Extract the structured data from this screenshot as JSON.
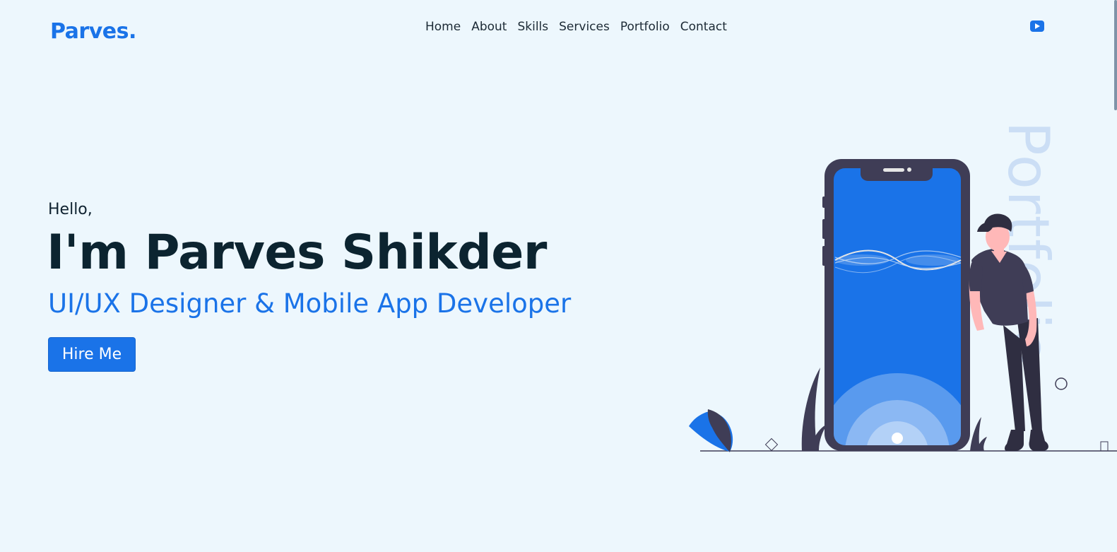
{
  "brand": {
    "logo": "Parves."
  },
  "nav": {
    "items": [
      {
        "label": "Home"
      },
      {
        "label": "About"
      },
      {
        "label": "Skills"
      },
      {
        "label": "Services"
      },
      {
        "label": "Portfolio"
      },
      {
        "label": "Contact"
      }
    ]
  },
  "social": {
    "icon": "youtube-icon"
  },
  "hero": {
    "greeting": "Hello,",
    "name": "I'm Parves Shikder",
    "role": "UI/UX Designer & Mobile App Developer",
    "cta_label": "Hire Me",
    "side_word": "Portfolio"
  },
  "colors": {
    "accent": "#1a73e8",
    "background": "#edf7fd",
    "heading": "#0c2430",
    "illustration_dark": "#3f3d56"
  }
}
